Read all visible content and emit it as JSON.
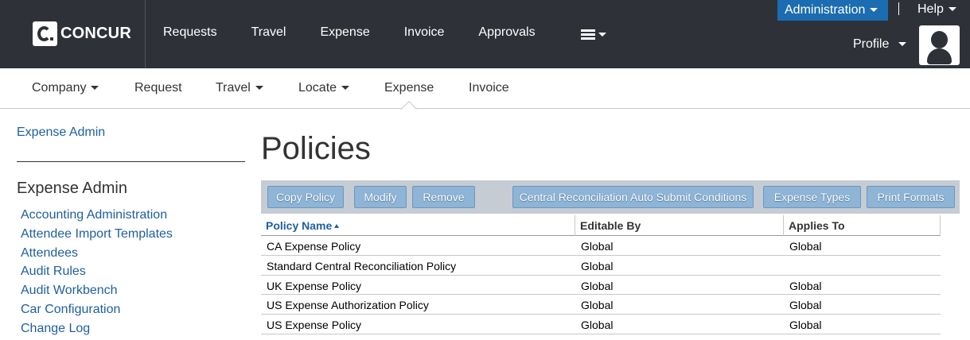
{
  "brand": {
    "name": "CONCUR"
  },
  "main_nav": [
    {
      "label": "Requests"
    },
    {
      "label": "Travel"
    },
    {
      "label": "Expense"
    },
    {
      "label": "Invoice"
    },
    {
      "label": "Approvals"
    }
  ],
  "top_right": {
    "administration_label": "Administration",
    "help_label": "Help",
    "profile_label": "Profile"
  },
  "sub_nav": [
    {
      "label": "Company",
      "has_dropdown": true
    },
    {
      "label": "Request",
      "has_dropdown": false
    },
    {
      "label": "Travel",
      "has_dropdown": true
    },
    {
      "label": "Locate",
      "has_dropdown": true
    },
    {
      "label": "Expense",
      "has_dropdown": false,
      "active": true
    },
    {
      "label": "Invoice",
      "has_dropdown": false
    }
  ],
  "sidebar": {
    "breadcrumb": "Expense Admin",
    "title": "Expense Admin",
    "items": [
      {
        "label": "Accounting Administration"
      },
      {
        "label": "Attendee Import Templates"
      },
      {
        "label": "Attendees"
      },
      {
        "label": "Audit Rules"
      },
      {
        "label": "Audit Workbench"
      },
      {
        "label": "Car Configuration"
      },
      {
        "label": "Change Log"
      }
    ]
  },
  "page": {
    "title": "Policies",
    "toolbar": {
      "copy_policy": "Copy Policy",
      "modify": "Modify",
      "remove": "Remove",
      "central_reconciliation": "Central Reconciliation Auto Submit Conditions",
      "expense_types": "Expense Types",
      "print_formats": "Print Formats"
    },
    "table": {
      "columns": {
        "policy_name": "Policy Name",
        "editable_by": "Editable By",
        "applies_to": "Applies To"
      },
      "rows": [
        {
          "policy_name": "CA Expense Policy",
          "editable_by": "Global",
          "applies_to": "Global"
        },
        {
          "policy_name": "Standard Central Reconciliation Policy",
          "editable_by": "Global",
          "applies_to": ""
        },
        {
          "policy_name": "UK Expense Policy",
          "editable_by": "Global",
          "applies_to": "Global"
        },
        {
          "policy_name": "US Expense Authorization Policy",
          "editable_by": "Global",
          "applies_to": "Global"
        },
        {
          "policy_name": "US Expense Policy",
          "editable_by": "Global",
          "applies_to": "Global"
        }
      ]
    }
  },
  "colors": {
    "top_bar": "#2e3138",
    "accent_blue": "#1b6cb0",
    "link": "#1f5f9e",
    "toolbar_bg": "#c5ccd4",
    "toolbar_button": "#8eb4d6"
  }
}
